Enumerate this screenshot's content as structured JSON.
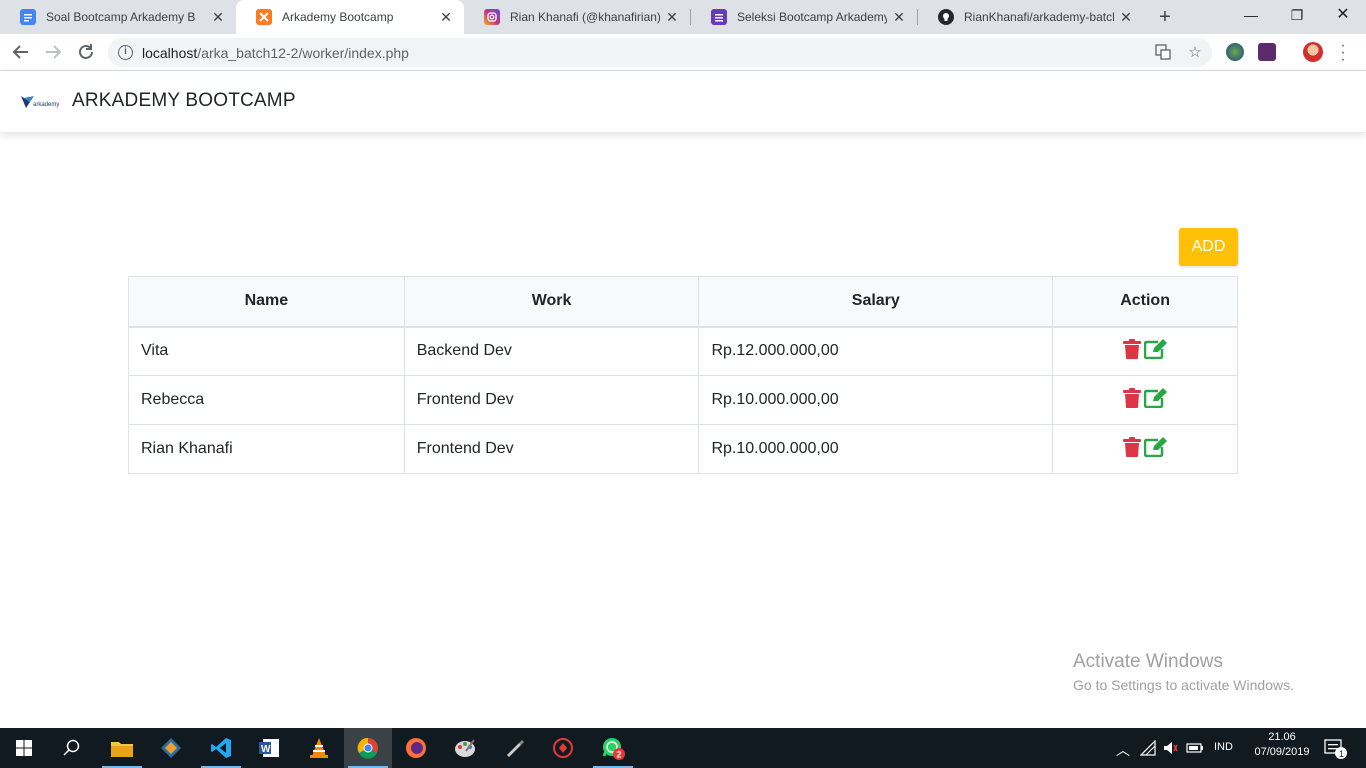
{
  "browser": {
    "tabs": [
      {
        "title": "Soal Bootcamp Arkademy Batc",
        "favicon": "docs-icon",
        "color": "#4285f4",
        "active": false
      },
      {
        "title": "Arkademy Bootcamp",
        "favicon": "xampp-icon",
        "color": "#fb7a24",
        "active": true
      },
      {
        "title": "Rian Khanafi (@khanafirian) • I",
        "favicon": "instagram-icon",
        "color": "#c13584",
        "active": false
      },
      {
        "title": "Seleksi Bootcamp Arkademy B",
        "favicon": "forms-icon",
        "color": "#673ab7",
        "active": false
      },
      {
        "title": "RianKhanafi/arkademy-batch-",
        "favicon": "github-icon",
        "color": "#24292e",
        "active": false
      }
    ],
    "url_host": "localhost",
    "url_path": "/arka_batch12-2/worker/index.php"
  },
  "navbar": {
    "brand": "ARKADEMY BOOTCAMP",
    "logo_text": "arkademy"
  },
  "add_button_label": "ADD",
  "table": {
    "headers": [
      "Name",
      "Work",
      "Salary",
      "Action"
    ],
    "rows": [
      {
        "name": "Vita",
        "work": "Backend Dev",
        "salary": "Rp.12.000.000,00"
      },
      {
        "name": "Rebecca",
        "work": "Frontend Dev",
        "salary": "Rp.10.000.000,00"
      },
      {
        "name": "Rian Khanafi",
        "work": "Frontend Dev",
        "salary": "Rp.10.000.000,00"
      }
    ]
  },
  "colors": {
    "delete": "#dc3545",
    "edit": "#28a745",
    "add": "#ffc107"
  },
  "watermark": {
    "line1": "Activate Windows",
    "line2": "Go to Settings to activate Windows."
  },
  "taskbar": {
    "language": "IND",
    "time": "21.06",
    "date": "07/09/2019",
    "whatsapp_badge": "2",
    "notification_count": "1"
  }
}
